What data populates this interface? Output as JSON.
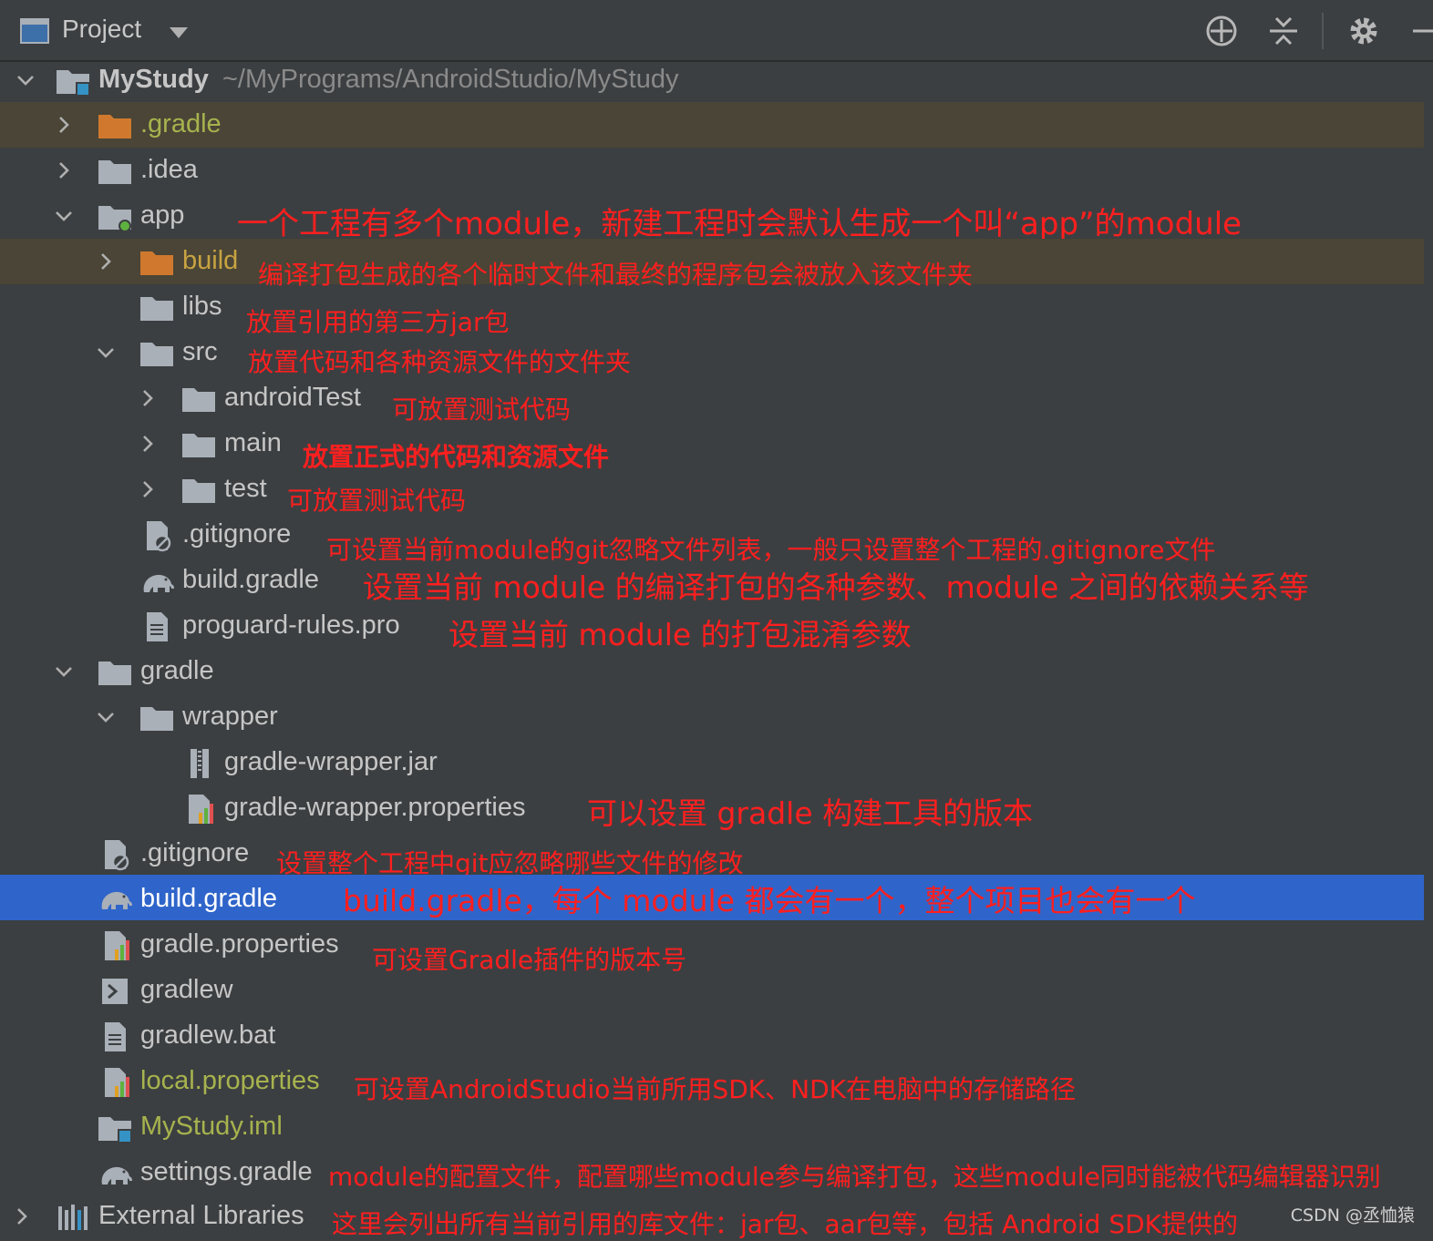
{
  "toolbar": {
    "title": "Project",
    "icons": [
      "project-window-icon",
      "dropdown-arrow-icon",
      "locate-icon",
      "collapse-all-icon",
      "gear-icon",
      "hide-icon"
    ]
  },
  "tree": {
    "root_name": "MyStudy",
    "root_path": "~/MyPrograms/AndroidStudio/MyStudy",
    "items": [
      {
        "label": ".gradle"
      },
      {
        "label": ".idea"
      },
      {
        "label": "app"
      },
      {
        "label": "build"
      },
      {
        "label": "libs"
      },
      {
        "label": "src"
      },
      {
        "label": "androidTest"
      },
      {
        "label": "main"
      },
      {
        "label": "test"
      },
      {
        "label": ".gitignore"
      },
      {
        "label": "build.gradle"
      },
      {
        "label": "proguard-rules.pro"
      },
      {
        "label": "gradle"
      },
      {
        "label": "wrapper"
      },
      {
        "label": "gradle-wrapper.jar"
      },
      {
        "label": "gradle-wrapper.properties"
      },
      {
        "label": ".gitignore"
      },
      {
        "label": "build.gradle"
      },
      {
        "label": "gradle.properties"
      },
      {
        "label": "gradlew"
      },
      {
        "label": "gradlew.bat"
      },
      {
        "label": "local.properties"
      },
      {
        "label": "MyStudy.iml"
      },
      {
        "label": "settings.gradle"
      },
      {
        "label": "External Libraries"
      }
    ]
  },
  "annotations": {
    "app": "一个工程有多个module，新建工程时会默认生成一个叫“app”的module",
    "build": "编译打包生成的各个临时文件和最终的程序包会被放入该文件夹",
    "libs": "放置引用的第三方jar包",
    "src": "放置代码和各种资源文件的文件夹",
    "androidTest": "可放置测试代码",
    "main": "放置正式的代码和资源文件",
    "test": "可放置测试代码",
    "app_gitignore": "可设置当前module的git忽略文件列表，一般只设置整个工程的.gitignore文件",
    "app_build_gradle": "设置当前 module 的编译打包的各种参数、module 之间的依赖关系等",
    "proguard": "设置当前 module 的打包混淆参数",
    "wrapper_properties": "可以设置 gradle 构建工具的版本",
    "root_gitignore": "设置整个工程中git应忽略哪些文件的修改",
    "root_build_gradle": "build.gradle，每个 module 都会有一个，整个项目也会有一个",
    "gradle_properties": "可设置Gradle插件的版本号",
    "local_properties": "可设置AndroidStudio当前所用SDK、NDK在电脑中的存储路径",
    "settings_gradle": "module的配置文件，配置哪些module参与编译打包，这些module同时能被代码编辑器识别",
    "external_libraries": "这里会列出所有当前引用的库文件：jar包、aar包等，包括 Android SDK提供的"
  },
  "watermark": "CSDN @丞恤猿",
  "colors": {
    "background": "#3c3f41",
    "selection": "#2f65ca",
    "highlight_row": "#4a4536",
    "annotation": "#ff1f1f",
    "folder": "#a9b0b8",
    "orange_folder": "#d0792e"
  }
}
